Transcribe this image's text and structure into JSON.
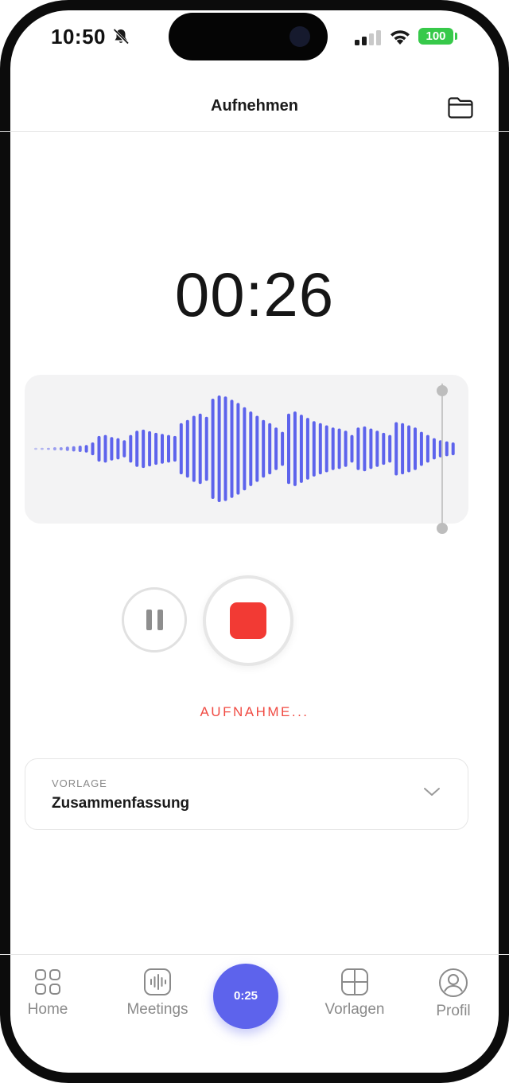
{
  "status_bar": {
    "time": "10:50",
    "battery": "100",
    "icons": [
      "bell-slash-icon",
      "cellular-signal-icon",
      "wifi-icon",
      "battery-icon"
    ]
  },
  "header": {
    "title": "Aufnehmen",
    "folder_icon": "folder-icon"
  },
  "recording": {
    "elapsed": "00:26",
    "status": "AUFNAHME...",
    "pause_icon": "pause-icon",
    "stop_icon": "stop-icon",
    "accent_color": "#5d63ec",
    "record_color": "#f23a34",
    "waveform_levels": [
      0.02,
      0.02,
      0.02,
      0.03,
      0.03,
      0.04,
      0.05,
      0.06,
      0.07,
      0.12,
      0.24,
      0.26,
      0.22,
      0.2,
      0.16,
      0.26,
      0.34,
      0.36,
      0.33,
      0.3,
      0.28,
      0.26,
      0.24,
      0.48,
      0.54,
      0.62,
      0.66,
      0.6,
      0.94,
      1.0,
      0.98,
      0.92,
      0.86,
      0.78,
      0.7,
      0.62,
      0.54,
      0.48,
      0.4,
      0.32,
      0.66,
      0.7,
      0.64,
      0.58,
      0.52,
      0.48,
      0.44,
      0.4,
      0.38,
      0.34,
      0.26,
      0.4,
      0.42,
      0.38,
      0.34,
      0.3,
      0.26,
      0.5,
      0.48,
      0.44,
      0.4,
      0.32,
      0.26,
      0.2,
      0.16,
      0.14,
      0.12
    ]
  },
  "template_card": {
    "label": "VORLAGE",
    "value": "Zusammenfassung",
    "chevron_icon": "chevron-down-icon"
  },
  "tab_bar": {
    "home": "Home",
    "meetings": "Meetings",
    "record_timer": "0:25",
    "vorlagen": "Vorlagen",
    "profil": "Profil"
  }
}
